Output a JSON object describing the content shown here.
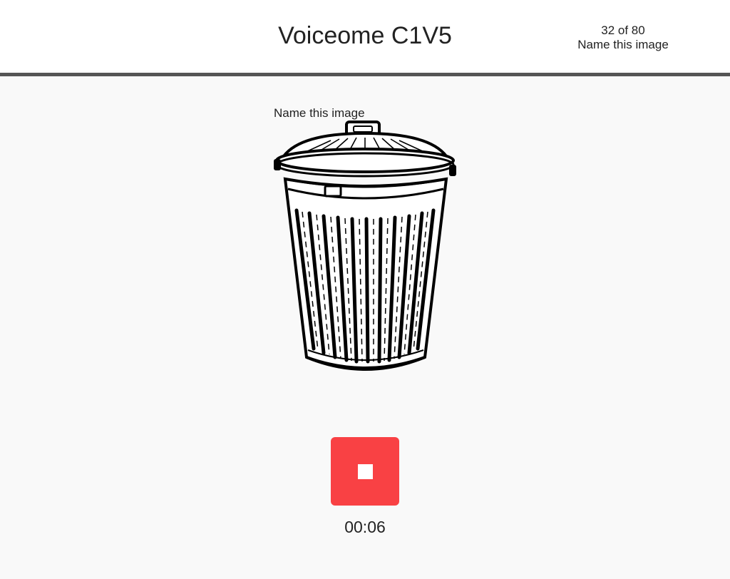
{
  "header": {
    "title": "Voiceome C1V5",
    "progress": "32 of 80",
    "task_name": "Name this image"
  },
  "task": {
    "prompt": "Name this image",
    "image_icon": "trash-can-icon"
  },
  "recorder": {
    "button_icon": "stop-icon",
    "button_color": "#f94144",
    "elapsed": "00:06"
  },
  "colors": {
    "header_bg": "#ffffff",
    "header_border": "#555555",
    "page_bg": "#f9f9f9"
  }
}
